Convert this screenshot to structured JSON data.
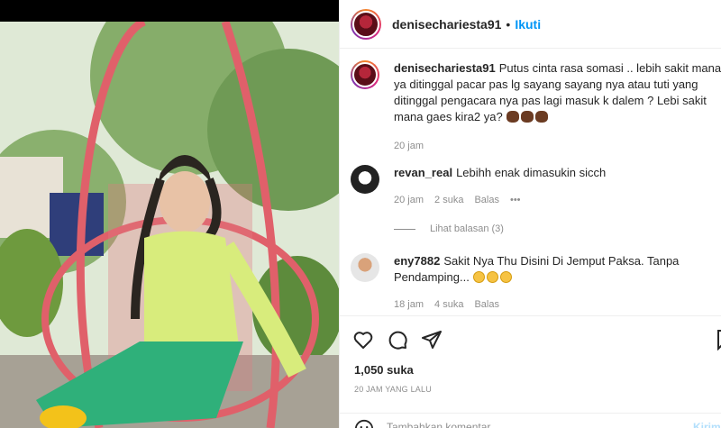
{
  "header": {
    "username": "denisechariesta91",
    "follow_label": "Ikuti",
    "separator": "•"
  },
  "caption": {
    "username": "denisechariesta91",
    "text": "Putus cinta rasa somasi .. lebih sakit mana ya ditinggal pacar pas lg sayang sayang nya atau tuti yang ditinggal pengacara nya pas lagi masuk k dalem ? Lebi sakit mana gaes kira2 ya?",
    "emoji": [
      "bear-emoji",
      "bear-emoji",
      "bear-emoji"
    ],
    "time": "20 jam"
  },
  "comments": [
    {
      "username": "revan_real",
      "text": "Lebihh enak dimasukin sicch",
      "time": "20 jam",
      "likes": "2 suka",
      "reply_label": "Balas",
      "more_label": "•••",
      "view_replies": "Lihat balasan (3)"
    },
    {
      "username": "eny7882",
      "text": "Sakit Nya Thu Disini Di Jemput Paksa. Tanpa Pendamping...",
      "emoji": [
        "disappointed-face-emoji",
        "disappointed-face-emoji",
        "disappointed-face-emoji"
      ],
      "time": "18 jam",
      "likes": "4 suka",
      "reply_label": "Balas"
    }
  ],
  "actions": {
    "icons": [
      "heart-icon",
      "comment-icon",
      "share-icon",
      "bookmark-icon"
    ],
    "likes": "1,050 suka",
    "posted": "20 JAM YANG LALU"
  },
  "add_comment": {
    "placeholder": "Tambahkan komentar...",
    "post_label": "Kirim"
  },
  "colors": {
    "accent": "#0095f6",
    "text": "#262626",
    "muted": "#8e8e8e",
    "border": "#efefef"
  }
}
